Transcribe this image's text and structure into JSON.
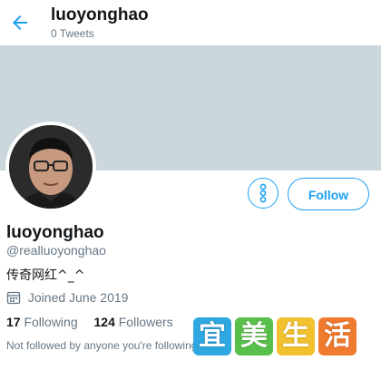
{
  "header": {
    "title": "luoyonghao",
    "subtitle": "0 Tweets",
    "back_icon": "back-arrow-icon"
  },
  "profile": {
    "name": "luoyonghao",
    "handle": "@realluoyonghao",
    "bio": "传奇网红^_^",
    "joined": "Joined June 2019",
    "following_count": "17",
    "following_label": "Following",
    "followers_count": "124",
    "followers_label": "Followers",
    "not_followed": "Not followed by anyone you're following"
  },
  "actions": {
    "more_icon": "more-options-icon",
    "follow_label": "Follow"
  },
  "watermark": {
    "chars": [
      "宜",
      "美",
      "生",
      "活"
    ]
  },
  "colors": {
    "accent": "#1da1f2",
    "banner": "#ccd6dd",
    "muted": "#657786"
  }
}
